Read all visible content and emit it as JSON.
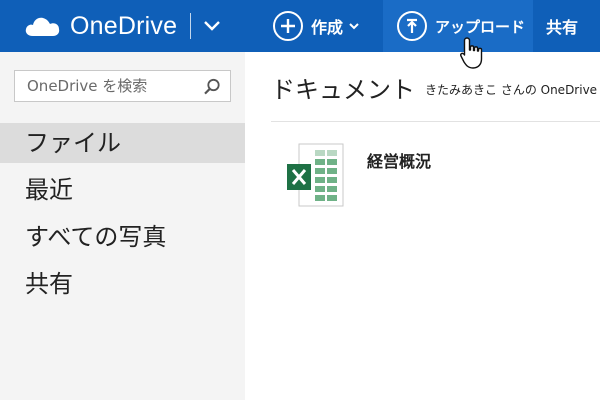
{
  "header": {
    "brand": "OneDrive",
    "create_label": "作成",
    "upload_label": "アップロード",
    "share_label": "共有"
  },
  "search": {
    "placeholder": "OneDrive を検索"
  },
  "sidebar": {
    "items": [
      {
        "label": "ファイル",
        "active": true
      },
      {
        "label": "最近"
      },
      {
        "label": "すべての写真"
      },
      {
        "label": "共有"
      }
    ]
  },
  "main": {
    "title": "ドキュメント",
    "owner": "きたみあきこ さんの OneDrive",
    "files": [
      {
        "name": "経営概況",
        "type": "excel-file-icon"
      }
    ]
  },
  "colors": {
    "topbar": "#0f5fb8",
    "upload_highlight": "#1a6cc6",
    "excel_green": "#1e7145",
    "sidebar_bg": "#f4f4f4",
    "active_item": "#dcdcdc"
  }
}
